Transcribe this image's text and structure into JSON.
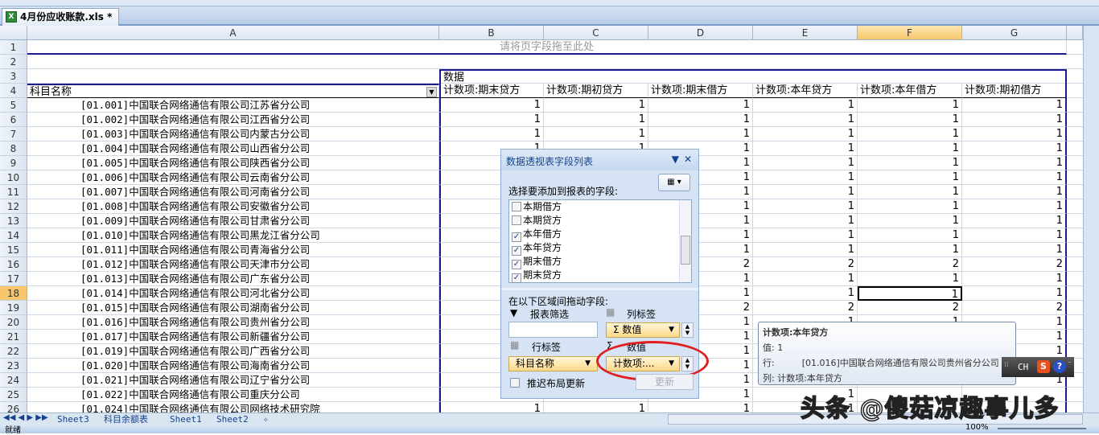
{
  "window": {
    "doc_tab": "4月份应收账款.xls *"
  },
  "columns": [
    "A",
    "B",
    "C",
    "D",
    "E",
    "F",
    "G"
  ],
  "selected_column": "F",
  "selected_row": 18,
  "pivot": {
    "page_drop_hint": "请将页字段拖至此处",
    "data_label": "数据",
    "row_header": "科目名称",
    "col_headers": [
      "计数项:期末贷方",
      "计数项:期初贷方",
      "计数项:期末借方",
      "计数项:本年贷方",
      "计数项:本年借方",
      "计数项:期初借方"
    ],
    "rows": [
      {
        "n": 5,
        "name": "[01.001]中国联合网络通信有限公司江苏省分公司",
        "v": [
          "1",
          "1",
          "1",
          "1",
          "1",
          "1"
        ]
      },
      {
        "n": 6,
        "name": "[01.002]中国联合网络通信有限公司江西省分公司",
        "v": [
          "1",
          "1",
          "1",
          "1",
          "1",
          "1"
        ]
      },
      {
        "n": 7,
        "name": "[01.003]中国联合网络通信有限公司内蒙古分公司",
        "v": [
          "1",
          "1",
          "1",
          "1",
          "1",
          "1"
        ]
      },
      {
        "n": 8,
        "name": "[01.004]中国联合网络通信有限公司山西省分公司",
        "v": [
          "1",
          "1",
          "1",
          "1",
          "1",
          "1"
        ]
      },
      {
        "n": 9,
        "name": "[01.005]中国联合网络通信有限公司陕西省分公司",
        "v": [
          "",
          "",
          "1",
          "1",
          "1",
          "1"
        ]
      },
      {
        "n": 10,
        "name": "[01.006]中国联合网络通信有限公司云南省分公司",
        "v": [
          "",
          "",
          "1",
          "1",
          "1",
          "1"
        ]
      },
      {
        "n": 11,
        "name": "[01.007]中国联合网络通信有限公司河南省分公司",
        "v": [
          "",
          "",
          "1",
          "1",
          "1",
          "1"
        ]
      },
      {
        "n": 12,
        "name": "[01.008]中国联合网络通信有限公司安徽省分公司",
        "v": [
          "",
          "",
          "1",
          "1",
          "1",
          "1"
        ]
      },
      {
        "n": 13,
        "name": "[01.009]中国联合网络通信有限公司甘肃省分公司",
        "v": [
          "",
          "",
          "1",
          "1",
          "1",
          "1"
        ]
      },
      {
        "n": 14,
        "name": "[01.010]中国联合网络通信有限公司黑龙江省分公司",
        "v": [
          "",
          "",
          "1",
          "1",
          "1",
          "1"
        ]
      },
      {
        "n": 15,
        "name": "[01.011]中国联合网络通信有限公司青海省分公司",
        "v": [
          "",
          "",
          "1",
          "1",
          "1",
          "1"
        ]
      },
      {
        "n": 16,
        "name": "[01.012]中国联合网络通信有限公司天津市分公司",
        "v": [
          "",
          "",
          "2",
          "2",
          "2",
          "2"
        ]
      },
      {
        "n": 17,
        "name": "[01.013]中国联合网络通信有限公司广东省分公司",
        "v": [
          "",
          "",
          "1",
          "1",
          "1",
          "1"
        ]
      },
      {
        "n": 18,
        "name": "[01.014]中国联合网络通信有限公司河北省分公司",
        "v": [
          "",
          "",
          "1",
          "1",
          "1",
          "1"
        ]
      },
      {
        "n": 19,
        "name": "[01.015]中国联合网络通信有限公司湖南省分公司",
        "v": [
          "",
          "",
          "2",
          "2",
          "2",
          "2"
        ]
      },
      {
        "n": 20,
        "name": "[01.016]中国联合网络通信有限公司贵州省分公司",
        "v": [
          "",
          "",
          "1",
          "1",
          "1",
          "1"
        ]
      },
      {
        "n": 21,
        "name": "[01.017]中国联合网络通信有限公司新疆省分公司",
        "v": [
          "",
          "",
          "1",
          "",
          "",
          "1"
        ]
      },
      {
        "n": 22,
        "name": "[01.019]中国联合网络通信有限公司广西省分公司",
        "v": [
          "",
          "",
          "1",
          "",
          "",
          "1"
        ]
      },
      {
        "n": 23,
        "name": "[01.020]中国联合网络通信有限公司海南省分公司",
        "v": [
          "",
          "",
          "1",
          "",
          "",
          "1"
        ]
      },
      {
        "n": 24,
        "name": "[01.021]中国联合网络通信有限公司辽宁省分公司",
        "v": [
          "",
          "",
          "1",
          "",
          "",
          "1"
        ]
      },
      {
        "n": 25,
        "name": "[01.022]中国联合网络通信有限公司重庆分公司",
        "v": [
          "",
          "",
          "1",
          "1",
          "",
          ""
        ]
      },
      {
        "n": 26,
        "name": "[01.024]中国联合网络通信有限公司网络技术研究院",
        "v": [
          "1",
          "1",
          "1",
          "1",
          "",
          ""
        ]
      }
    ]
  },
  "field_panel": {
    "title": "数据透视表字段列表",
    "choose_label": "选择要添加到报表的字段:",
    "fields": [
      {
        "label": "本期借方",
        "checked": false
      },
      {
        "label": "本期贷方",
        "checked": false
      },
      {
        "label": "本年借方",
        "checked": true
      },
      {
        "label": "本年贷方",
        "checked": true
      },
      {
        "label": "期末借方",
        "checked": true
      },
      {
        "label": "期末贷方",
        "checked": true
      }
    ],
    "drag_label": "在以下区域间拖动字段:",
    "report_filter": "报表筛选",
    "column_labels": "列标签",
    "column_item": "Σ 数值",
    "row_labels": "行标签",
    "values": "数值",
    "row_item": "科目名称",
    "value_item": "计数项:...",
    "defer_label": "推迟布局更新",
    "update_button": "更新"
  },
  "tooltip": {
    "title": "计数项:本年贷方",
    "value": "值: 1",
    "row_label": "行:",
    "row_value": "[01.016]中国联合网络通信有限公司贵州省分公司",
    "col": "列: 计数项:本年贷方"
  },
  "ime": {
    "label": "CH"
  },
  "sheets": [
    "Sheet3",
    "科目余额表",
    "Sheet1",
    "Sheet2"
  ],
  "status": {
    "ready": "就绪",
    "zoom": "100%"
  },
  "watermark": "头条 @傻菇凉趣事儿多",
  "colors": {
    "pivot_border": "#1a1a8c",
    "selection": "#f8c76b",
    "highlight_circle": "#e02020"
  }
}
